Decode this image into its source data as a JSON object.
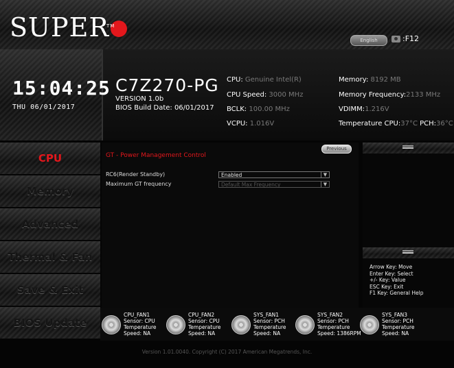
{
  "header": {
    "logo_text": "SUPER",
    "logo_tm": "TM",
    "language": "English",
    "screenshot_key": ":F12"
  },
  "system": {
    "time": "15:04:25",
    "date": "THU 06/01/2017",
    "board_name": "C7Z270-PG",
    "version": "VERSION 1.0b",
    "bios_build_date": "BIOS Build Date: 06/01/2017",
    "cpu_label": "CPU:",
    "cpu_value": "Genuine Intel(R)",
    "cpu_speed_label": "CPU Speed:",
    "cpu_speed_value": "3000 MHz",
    "bclk_label": "BCLK:",
    "bclk_value": "100.00 MHz",
    "vcpu_label": "VCPU:",
    "vcpu_value": "1.016V",
    "memory_label": "Memory:",
    "memory_value": "8192 MB",
    "memory_freq_label": "Memory Frequency:",
    "memory_freq_value": "2133 MHz",
    "vdimm_label": "VDIMM:",
    "vdimm_value": "1.216V",
    "temp_cpu_label": "Temperature CPU:",
    "temp_cpu_value": "37°C",
    "temp_pch_label": "PCH:",
    "temp_pch_value": "36°C"
  },
  "nav": {
    "items": [
      {
        "label": "CPU"
      },
      {
        "label": "Memory"
      },
      {
        "label": "Advanced"
      },
      {
        "label": "Thermal & Fan"
      },
      {
        "label": "Save & Exit"
      },
      {
        "label": "BIOS Update"
      }
    ]
  },
  "main": {
    "section_title": "GT - Power Management Control",
    "previous_label": "Previous",
    "settings": [
      {
        "label": "RC6(Render Standby)",
        "value": "Enabled"
      },
      {
        "label": "Maximum GT frequency",
        "value": "Default Max Frequency"
      }
    ]
  },
  "help": {
    "lines": [
      "Arrow Key: Move",
      "Enter Key: Select",
      "+/- Key: Value",
      "ESC Key: Exit",
      "F1 Key: General Help"
    ]
  },
  "fans": [
    {
      "name": "CPU_FAN1",
      "sensor": "Sensor: CPU",
      "temp": "Temperature",
      "speed": "Speed:  NA"
    },
    {
      "name": "CPU_FAN2",
      "sensor": "Sensor: CPU",
      "temp": "Temperature",
      "speed": "Speed:  NA"
    },
    {
      "name": "SYS_FAN1",
      "sensor": "Sensor: PCH",
      "temp": "Temperature",
      "speed": "Speed:  NA"
    },
    {
      "name": "SYS_FAN2",
      "sensor": "Sensor: PCH",
      "temp": "Temperature",
      "speed": "Speed:  1386RPM"
    },
    {
      "name": "SYS_FAN3",
      "sensor": "Sensor: PCH",
      "temp": "Temperature",
      "speed": "Speed:  NA"
    }
  ],
  "footer": "Version 1.01.0040. Copyright (C) 2017 American Megatrends, Inc.",
  "colors": {
    "accent": "#e3171c",
    "dim_value": "#7a7a7a"
  }
}
